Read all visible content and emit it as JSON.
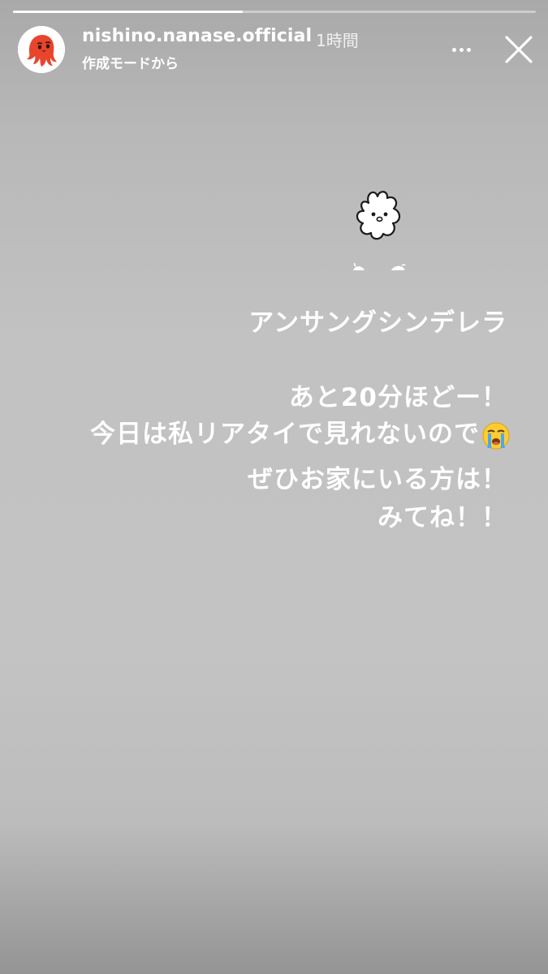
{
  "progress": {
    "fraction": 0.44
  },
  "header": {
    "avatar_icon": "octopus-avatar",
    "username": "nishino.nanase.official",
    "time_ago": "1時間",
    "source": "作成モードから",
    "more_icon": "more-dots-icon",
    "close_icon": "close-icon"
  },
  "story": {
    "sticker_icon": "white-bunny-sticker",
    "lines": [
      "アンサングシンデレラ",
      "あと20分ほどー！",
      "今日は私リアタイで見れないので",
      "ぜひお家にいる方は！",
      "みてね！！"
    ],
    "emoji": "loudly-crying-face-emoji"
  },
  "colors": {
    "avatar_octopus": "#e8452c",
    "text": "#ffffff",
    "background": "#c3c3c3"
  }
}
